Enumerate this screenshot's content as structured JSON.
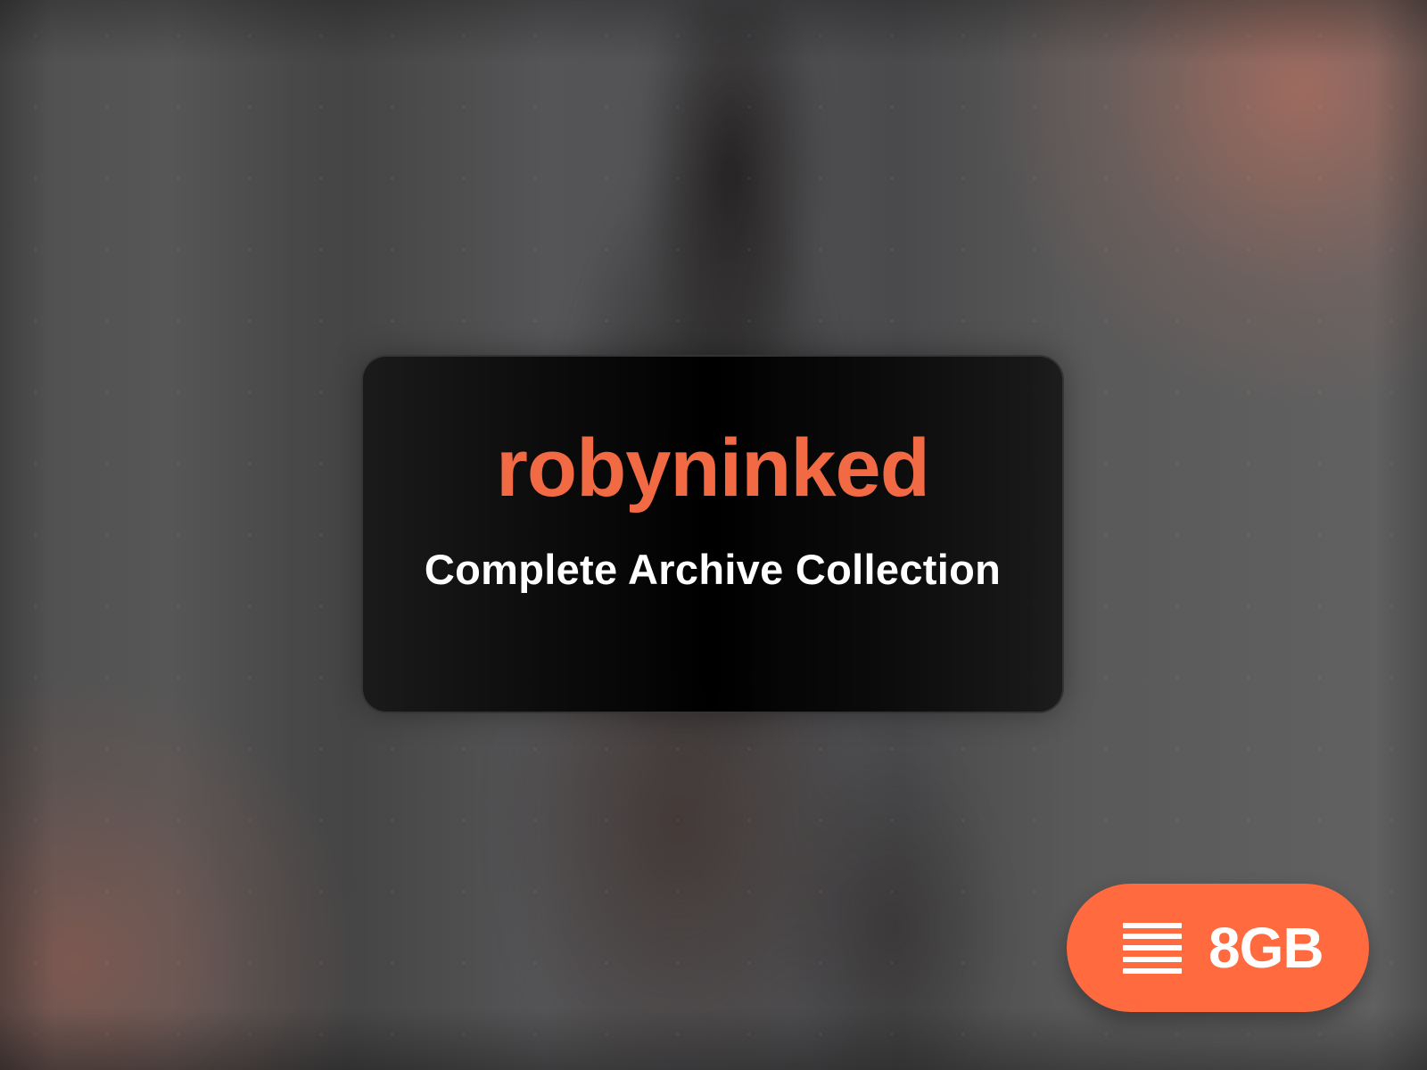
{
  "card": {
    "title": "robyninked",
    "subtitle": "Complete Archive Collection"
  },
  "size_badge": {
    "icon": "archive-lines-icon",
    "label": "8GB"
  },
  "colors": {
    "accent": "#f26a44",
    "badge_background": "#ff6a3f",
    "text": "#ffffff",
    "card_background": "#050505"
  }
}
